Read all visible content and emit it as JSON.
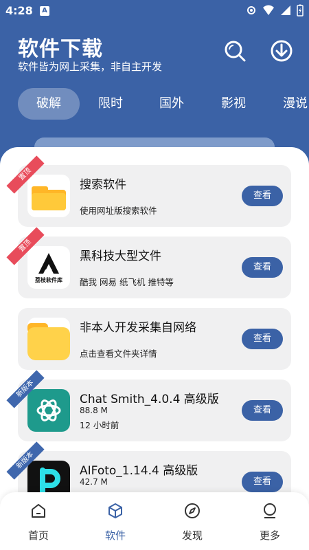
{
  "status": {
    "time": "4:28",
    "badge": "A"
  },
  "header": {
    "title": "软件下载",
    "subtitle": "软件皆为网上采集，非自主开发"
  },
  "tabs": [
    "破解",
    "限时",
    "国外",
    "影视",
    "漫说"
  ],
  "apps": [
    {
      "name": "搜索软件",
      "size": "",
      "desc": "使用网址版搜索软件",
      "ribbon": "置顶",
      "ribbon_color": "red",
      "button": "查看",
      "icon": "folder-icon"
    },
    {
      "name": "黑科技大型文件",
      "size": "",
      "desc": "酷我 网易 纸飞机 推特等",
      "ribbon": "置顶",
      "ribbon_color": "red",
      "button": "查看",
      "icon": "logo-icon",
      "logo_text": "荔枝软件库"
    },
    {
      "name": "非本人开发采集自网络",
      "size": "",
      "desc": "点击查看文件夹详情",
      "ribbon": "",
      "ribbon_color": "",
      "button": "查看",
      "icon": "folder-icon"
    },
    {
      "name": "Chat Smith_4.0.4 高级版",
      "size": "88.8 M",
      "desc": "12 小时前",
      "ribbon": "新版本",
      "ribbon_color": "blue",
      "button": "查看",
      "icon": "chatsmith-icon"
    },
    {
      "name": "AIFoto_1.14.4 高级版",
      "size": "42.7 M",
      "desc": "",
      "ribbon": "新版本",
      "ribbon_color": "blue",
      "button": "查看",
      "icon": "aifoto-icon"
    }
  ],
  "nav": [
    {
      "label": "首页",
      "icon": "home-icon"
    },
    {
      "label": "软件",
      "icon": "box-icon"
    },
    {
      "label": "发现",
      "icon": "compass-icon"
    },
    {
      "label": "更多",
      "icon": "user-icon"
    }
  ],
  "colors": {
    "primary": "#3b62a6",
    "ribbon_red": "#e84c5b",
    "folder_yellow": "#ffc93a"
  }
}
